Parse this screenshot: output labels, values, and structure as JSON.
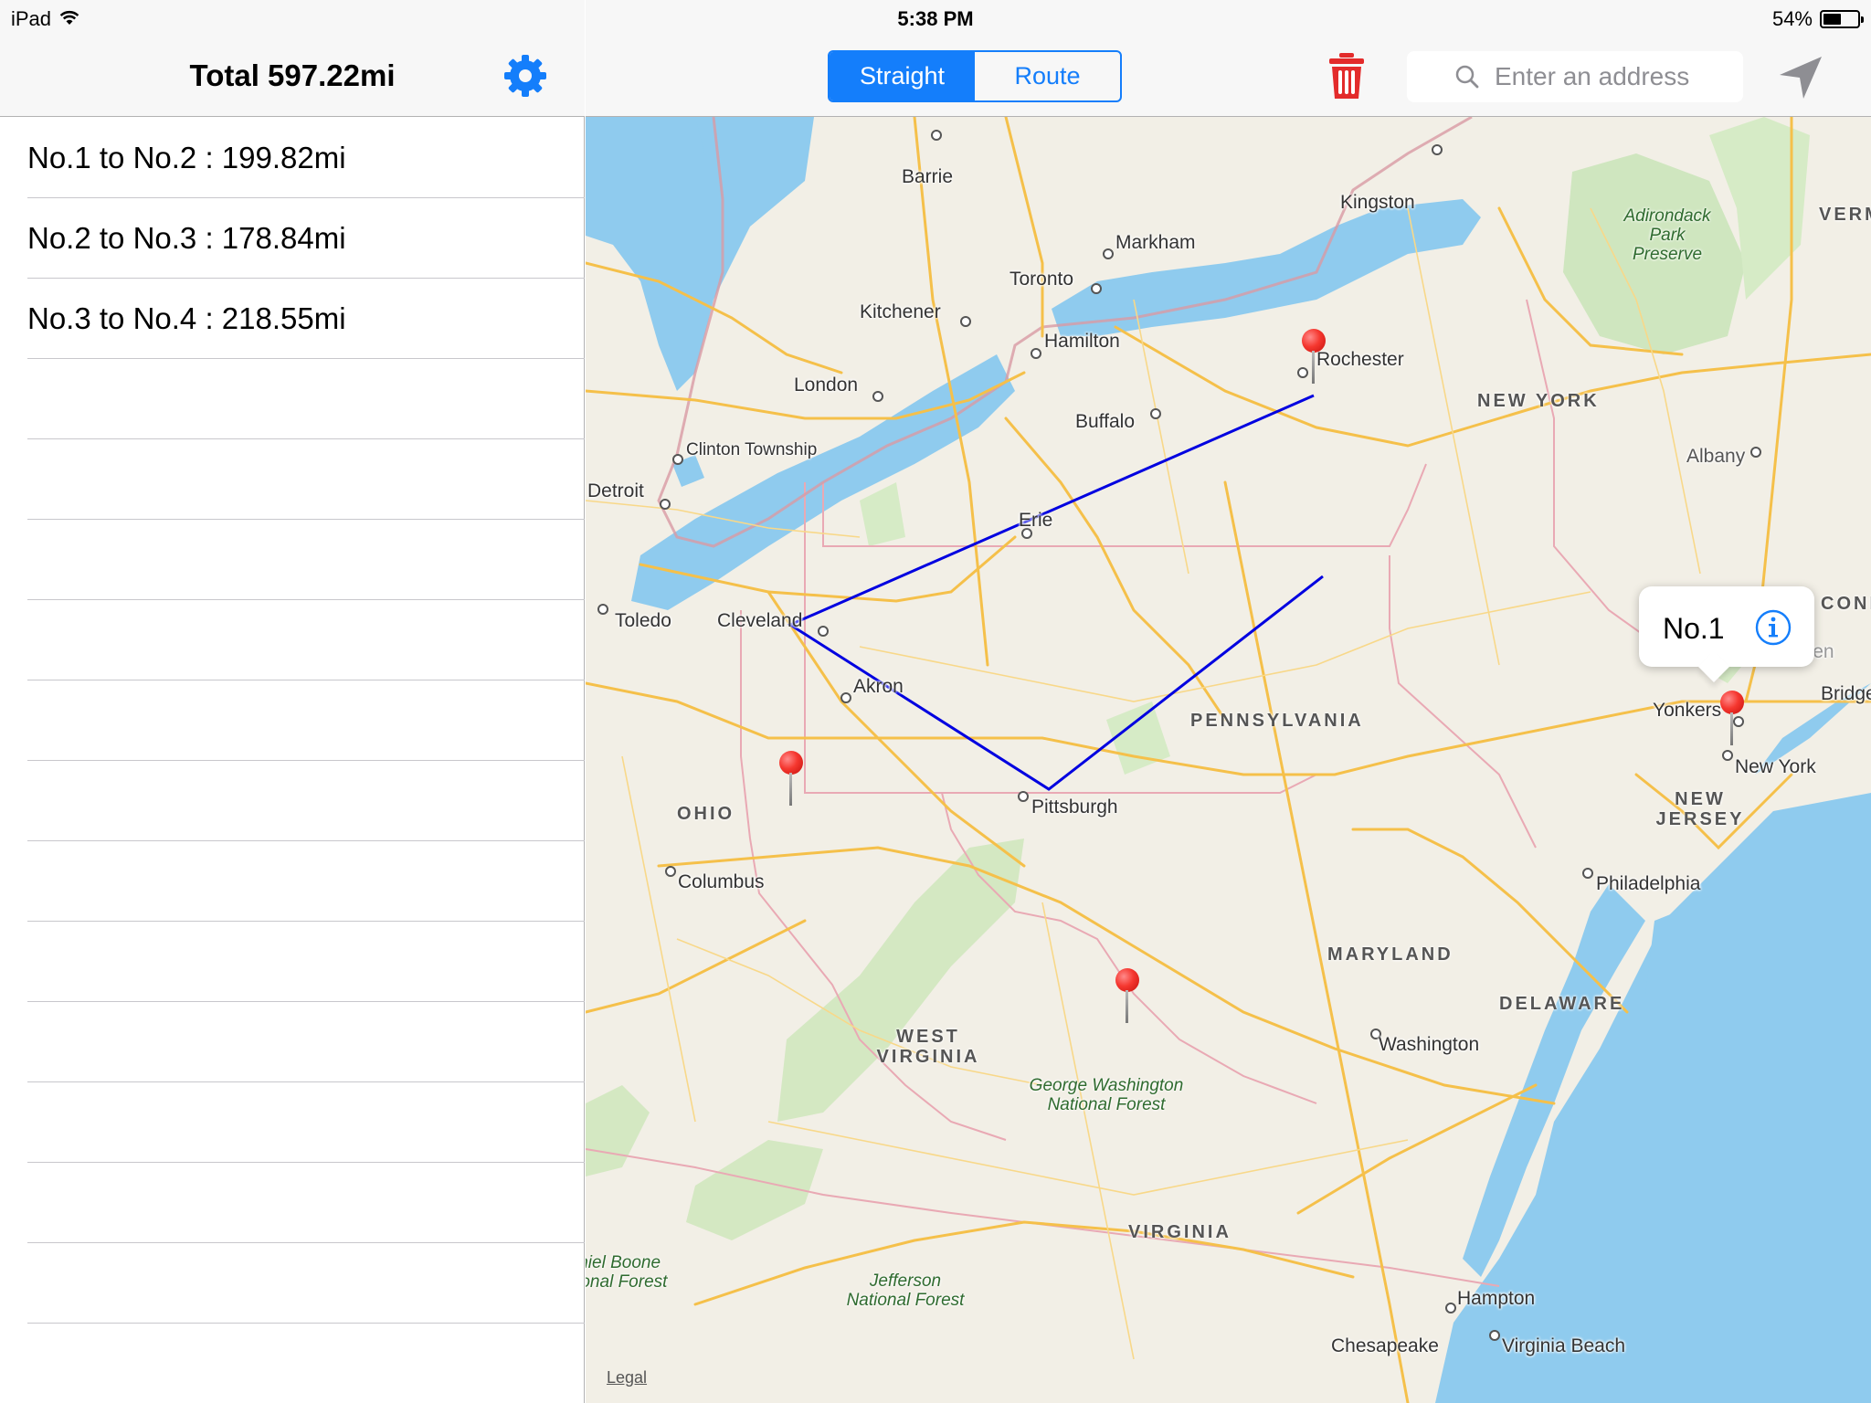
{
  "status_bar": {
    "device": "iPad",
    "time": "5:38 PM",
    "battery_text": "54%",
    "battery_level": 0.54
  },
  "sidebar": {
    "title": "Total 597.22mi",
    "rows": [
      "No.1 to No.2 : 199.82mi",
      "No.2 to No.3 : 178.84mi",
      "No.3 to No.4 : 218.55mi",
      "",
      "",
      "",
      "",
      "",
      "",
      "",
      "",
      "",
      "",
      "",
      "",
      ""
    ]
  },
  "toolbar": {
    "segments": [
      "Straight",
      "Route"
    ],
    "selected_segment": "Straight",
    "search_placeholder": "Enter an address",
    "accent_color": "#147efb",
    "trash_color": "#e32b2b"
  },
  "map": {
    "callout_title": "No.1",
    "legal": "Legal",
    "route_color": "#0000e0",
    "cities": [
      "Barrie",
      "Kingston",
      "Markham",
      "Toronto",
      "Kitchener",
      "Hamilton",
      "Rochester",
      "London",
      "Buffalo",
      "Clinton Township",
      "Detroit",
      "Erie",
      "Toledo",
      "Cleveland",
      "Akron",
      "Pittsburgh",
      "Columbus",
      "Albany",
      "Yonkers",
      "New York",
      "New Haven",
      "Bridgeport",
      "Philadelphia",
      "Washington",
      "Hampton",
      "Chesapeake",
      "Virginia Beach"
    ],
    "states": [
      "NEW YORK",
      "PENNSYLVANIA",
      "OHIO",
      "NEW JERSEY",
      "MARYLAND",
      "DELAWARE",
      "WEST VIRGINIA",
      "VIRGINIA",
      "VERMONT",
      "CONN"
    ],
    "parks": [
      "Adirondack Park Preserve",
      "George Washington National Forest",
      "Jefferson National Forest",
      "Daniel Boone National Forest"
    ]
  }
}
